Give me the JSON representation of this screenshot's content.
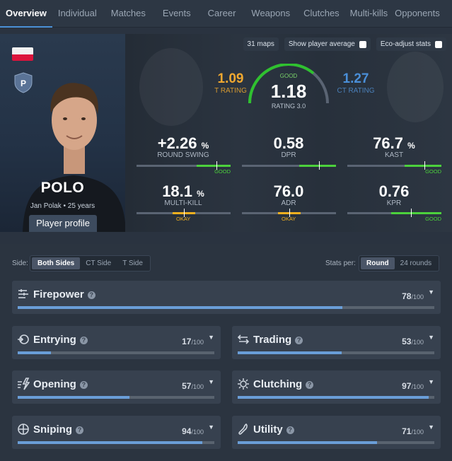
{
  "tabs": [
    "Overview",
    "Individual",
    "Matches",
    "Events",
    "Career",
    "Weapons",
    "Clutches",
    "Multi-kills",
    "Opponents"
  ],
  "controls": {
    "maps": "31 maps",
    "player_avg": "Show player average",
    "eco": "Eco-adjust stats"
  },
  "player": {
    "name": "POLO",
    "sub": "Jan Polak • 25 years",
    "profile_button": "Player profile",
    "badge": "P",
    "country": "Poland"
  },
  "ratings": {
    "t": {
      "value": "1.09",
      "label": "T RATING"
    },
    "ct": {
      "value": "1.27",
      "label": "CT RATING"
    },
    "main": {
      "value": "1.18",
      "label": "RATING 3.0",
      "tag": "GOOD",
      "level": 0.72
    }
  },
  "stats": [
    {
      "value": "+2.26",
      "unit": "%",
      "label": "ROUND SWING",
      "tag": "GOOD",
      "tag_color": "#4cd13c",
      "level": 0.85
    },
    {
      "value": "0.58",
      "unit": "",
      "label": "DPR",
      "tag": "",
      "tag_color": "#4cd13c",
      "level": 0.82
    },
    {
      "value": "76.7",
      "unit": "%",
      "label": "KAST",
      "tag": "GOOD",
      "tag_color": "#4cd13c",
      "level": 0.82
    },
    {
      "value": "18.1",
      "unit": "%",
      "label": "MULTI-KILL",
      "tag": "OKAY",
      "tag_color": "#f0b020",
      "level": 0.5
    },
    {
      "value": "76.0",
      "unit": "",
      "label": "ADR",
      "tag": "OKAY",
      "tag_color": "#f0b020",
      "level": 0.5
    },
    {
      "value": "0.76",
      "unit": "",
      "label": "KPR",
      "tag": "GOOD",
      "tag_color": "#4cd13c",
      "level": 0.68
    }
  ],
  "filters": {
    "side_label": "Side:",
    "sides": [
      "Both Sides",
      "CT Side",
      "T Side"
    ],
    "per_label": "Stats per:",
    "per": [
      "Round",
      "24 rounds"
    ]
  },
  "categories": [
    {
      "name": "Firepower",
      "icon": "firepower-icon",
      "score": "78",
      "den": "/100"
    },
    {
      "name": "Entrying",
      "icon": "entrying-icon",
      "score": "17",
      "den": "/100"
    },
    {
      "name": "Trading",
      "icon": "trading-icon",
      "score": "53",
      "den": "/100"
    },
    {
      "name": "Opening",
      "icon": "opening-icon",
      "score": "57",
      "den": "/100"
    },
    {
      "name": "Clutching",
      "icon": "clutching-icon",
      "score": "97",
      "den": "/100"
    },
    {
      "name": "Sniping",
      "icon": "sniping-icon",
      "score": "94",
      "den": "/100"
    },
    {
      "name": "Utility",
      "icon": "utility-icon",
      "score": "71",
      "den": "/100"
    }
  ],
  "colors": {
    "accent": "#4a90d6",
    "good": "#4cd13c",
    "okay": "#f0b020",
    "t_side": "#f0a830",
    "ct_side": "#4a8fd8",
    "bar": "#6a9ed8"
  }
}
